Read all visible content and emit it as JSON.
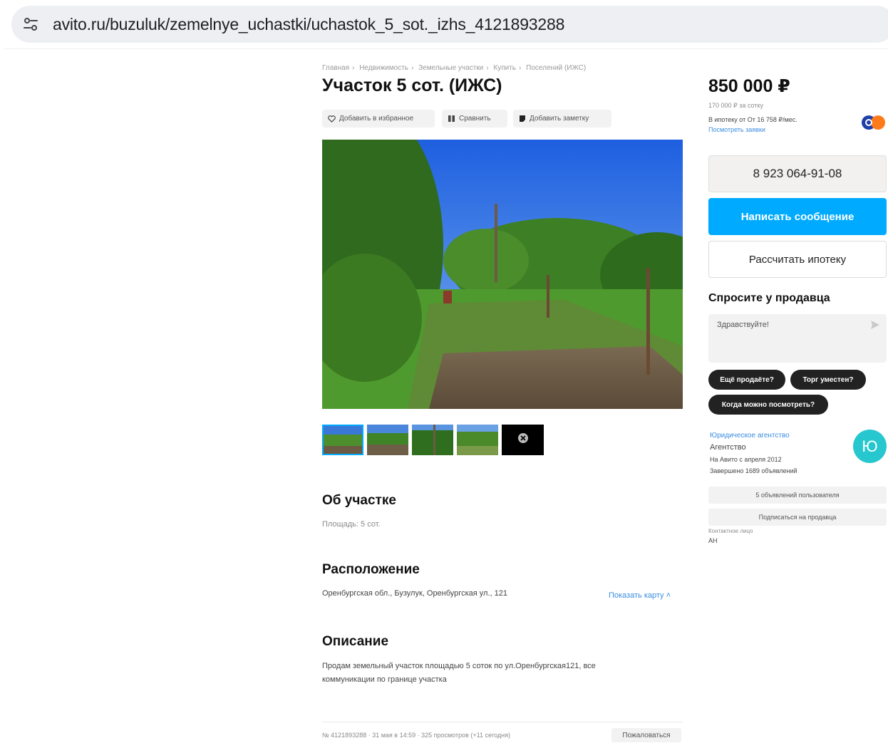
{
  "browser": {
    "url": "avito.ru/buzuluk/zemelnye_uchastki/uchastok_5_sot._izhs_4121893288"
  },
  "breadcrumbs": [
    "Главная",
    "Недвижимость",
    "Земельные участки",
    "Купить",
    "Поселений (ИЖС)"
  ],
  "listing": {
    "title": "Участок 5 сот. (ИЖС)",
    "actions": {
      "favorite": "Добавить в избранное",
      "compare": "Сравнить",
      "note": "Добавить заметку"
    },
    "about": {
      "heading": "Об участке",
      "area_label": "Площадь:",
      "area_value": "5 сот."
    },
    "location": {
      "heading": "Расположение",
      "address": "Оренбургская обл., Бузулук, Оренбургская ул., 121",
      "map_link": "Показать карту ˄"
    },
    "description": {
      "heading": "Описание",
      "line1": "Продам земельный участок площадью 5 соток по ул.Оренбургская121, все",
      "line2": "коммуникации по границе участка"
    },
    "footer": {
      "meta": "№ 4121893288 · 31 мая в 14:59 · 325 просмотров (+11 сегодня)",
      "complain": "Пожаловаться"
    }
  },
  "sidebar": {
    "price": "850 000 ₽",
    "price_per_unit": "170 000 ₽ за сотку",
    "mortgage_line": "В ипотеку от От 16 758 ₽/мес.",
    "mortgage_link": "Посмотреть заявки",
    "phone": "8 923 064-91-08",
    "message_button": "Написать сообщение",
    "mortgage_button": "Рассчитать ипотеку",
    "ask_heading": "Спросите у продавца",
    "ask_placeholder": "Здравствуйте!",
    "chips": [
      "Ещё продаёте?",
      "Торг уместен?",
      "Когда можно посмотреть?"
    ],
    "seller": {
      "name": "Юридическое агентство",
      "type": "Агентство",
      "since": "На Авито с апреля 2012",
      "completed": "Завершено 1689 объявлений",
      "avatar_letter": "Ю",
      "ads_button": "5 объявлений пользователя",
      "subscribe_button": "Подписаться на продавца",
      "contact_label": "Контактное лицо",
      "contact_value": "АН"
    }
  },
  "colors": {
    "accent": "#00aaff",
    "chip": "#222222",
    "avatar": "#27c7cf",
    "link": "#3a8de0"
  },
  "icons": {
    "site_info": "tune-icon",
    "favorite": "heart-icon",
    "compare": "compare-icon",
    "note": "note-icon",
    "send": "send-icon",
    "gallery_more": "close-circle-icon"
  }
}
